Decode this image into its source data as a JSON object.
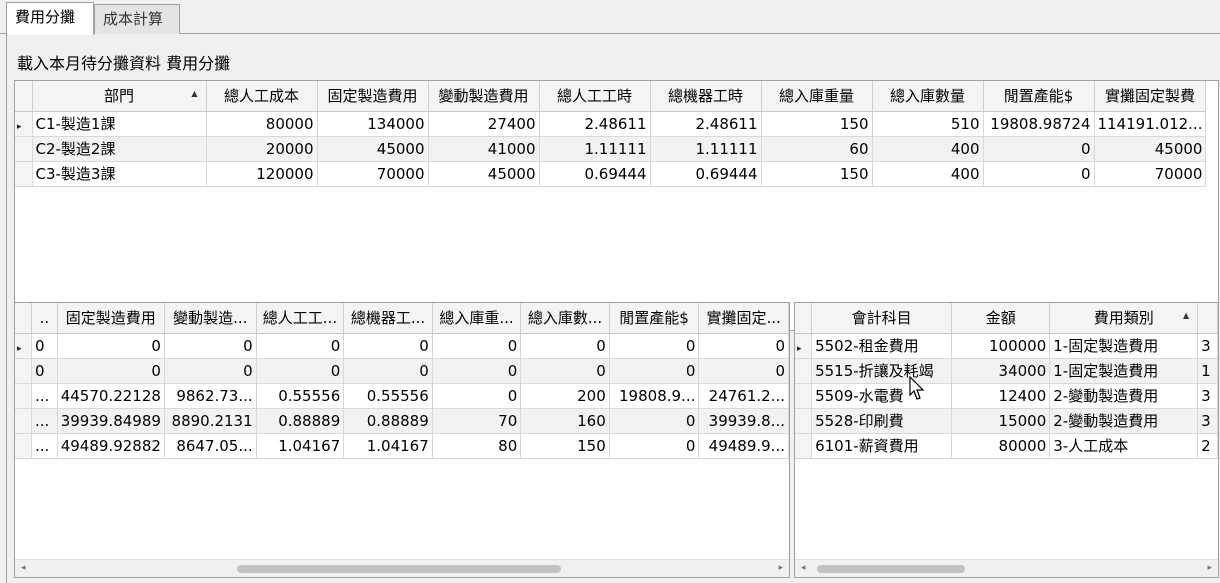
{
  "tabs": [
    {
      "label": "費用分攤"
    },
    {
      "label": "成本計算"
    }
  ],
  "title": "載入本月待分攤資料 費用分攤",
  "grid1": {
    "headers": [
      "部門",
      "總人工成本",
      "固定製造費用",
      "變動製造費用",
      "總人工工時",
      "總機器工時",
      "總入庫重量",
      "總入庫數量",
      "閒置產能$",
      "實攤固定製費"
    ],
    "rows": [
      [
        "C1-製造1課",
        "80000",
        "134000",
        "27400",
        "2.48611",
        "2.48611",
        "150",
        "510",
        "19808.98724",
        "114191.012..."
      ],
      [
        "C2-製造2課",
        "20000",
        "45000",
        "41000",
        "1.11111",
        "1.11111",
        "60",
        "400",
        "0",
        "45000"
      ],
      [
        "C3-製造3課",
        "120000",
        "70000",
        "45000",
        "0.69444",
        "0.69444",
        "150",
        "400",
        "0",
        "70000"
      ]
    ]
  },
  "grid2": {
    "headers": [
      "..",
      "固定製造費用",
      "變動製造...",
      "總人工工...",
      "總機器工...",
      "總入庫重...",
      "總入庫數...",
      "閒置產能$",
      "實攤固定..."
    ],
    "rows": [
      [
        "0",
        "0",
        "0",
        "0",
        "0",
        "0",
        "0",
        "0",
        "0"
      ],
      [
        "0",
        "0",
        "0",
        "0",
        "0",
        "0",
        "0",
        "0",
        "0"
      ],
      [
        "...",
        "44570.22128",
        "9862.73...",
        "0.55556",
        "0.55556",
        "0",
        "200",
        "19808.9...",
        "24761.2..."
      ],
      [
        "...",
        "39939.84989",
        "8890.2131",
        "0.88889",
        "0.88889",
        "70",
        "160",
        "0",
        "39939.8..."
      ],
      [
        "...",
        "49489.92882",
        "8647.05...",
        "1.04167",
        "1.04167",
        "80",
        "150",
        "0",
        "49489.9..."
      ]
    ]
  },
  "grid3": {
    "headers": [
      "會計科目",
      "金額",
      "費用類別"
    ],
    "rows": [
      [
        "5502-租金費用",
        "100000",
        "1-固定製造費用",
        "3"
      ],
      [
        "5515-折讓及耗竭",
        "34000",
        "1-固定製造費用",
        "1"
      ],
      [
        "5509-水電費",
        "12400",
        "2-變動製造費用",
        "3"
      ],
      [
        "5528-印刷費",
        "15000",
        "2-變動製造費用",
        "3"
      ],
      [
        "6101-薪資費用",
        "80000",
        "3-人工成本",
        "2"
      ]
    ]
  }
}
